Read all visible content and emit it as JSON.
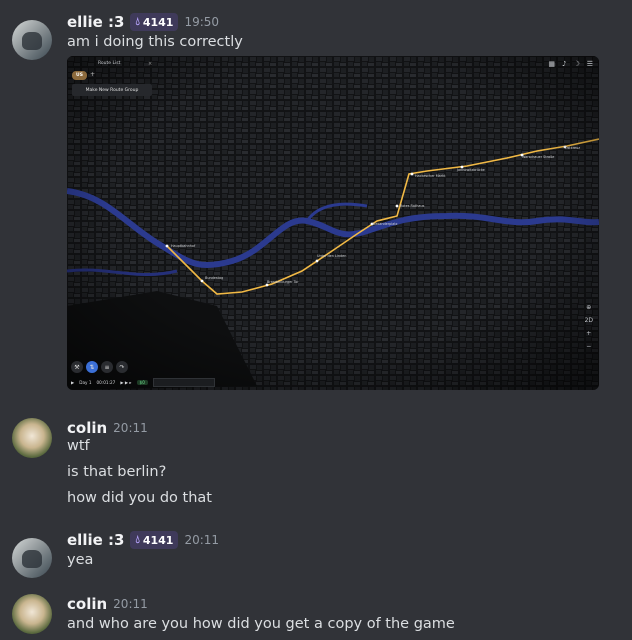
{
  "messages": [
    {
      "username": "ellie :3",
      "badge": "4141",
      "time": "19:50",
      "lines": [
        "am i doing this correctly"
      ],
      "embed": {
        "tab_title": "Route List",
        "tab_close": "×",
        "region_chip": "US",
        "add_chip": "+",
        "make_group_button": "Make New Route Group",
        "top_icons": [
          "map-icon",
          "sound-icon",
          "moon-icon",
          "menu-icon"
        ],
        "right_tools": [
          "⊕",
          "2D",
          "+",
          "−"
        ],
        "map_labels": [
          "Hauptbahnhof",
          "Bundestag",
          "Brandenburger Tor",
          "Unter den Linden",
          "Alexanderplatz",
          "Rotes Rathaus",
          "Hackescher Markt",
          "Warschauer Straße",
          "Jannowitzbrücke",
          "Ostkreuz"
        ],
        "day": "Day 1",
        "clock": "00:01:27",
        "speed": "▶ ▶ ▸",
        "money": "$0",
        "play": "▶"
      }
    },
    {
      "username": "colin",
      "time": "20:11",
      "lines": [
        "wtf",
        "is that berlin?",
        "how did you do that"
      ]
    },
    {
      "username": "ellie :3",
      "badge": "4141",
      "time": "20:11",
      "lines": [
        "yea"
      ]
    },
    {
      "username": "colin",
      "time": "20:11",
      "lines": [
        "and who are you how did you get a copy of the game"
      ]
    }
  ],
  "colors": {
    "background": "#313338",
    "username": "#f2f3f5",
    "text": "#dbdee1",
    "timestamp": "#949ba4",
    "badge_bg": "#3f3a5a",
    "route": "#f1b945",
    "river": "#2a3a8a"
  }
}
